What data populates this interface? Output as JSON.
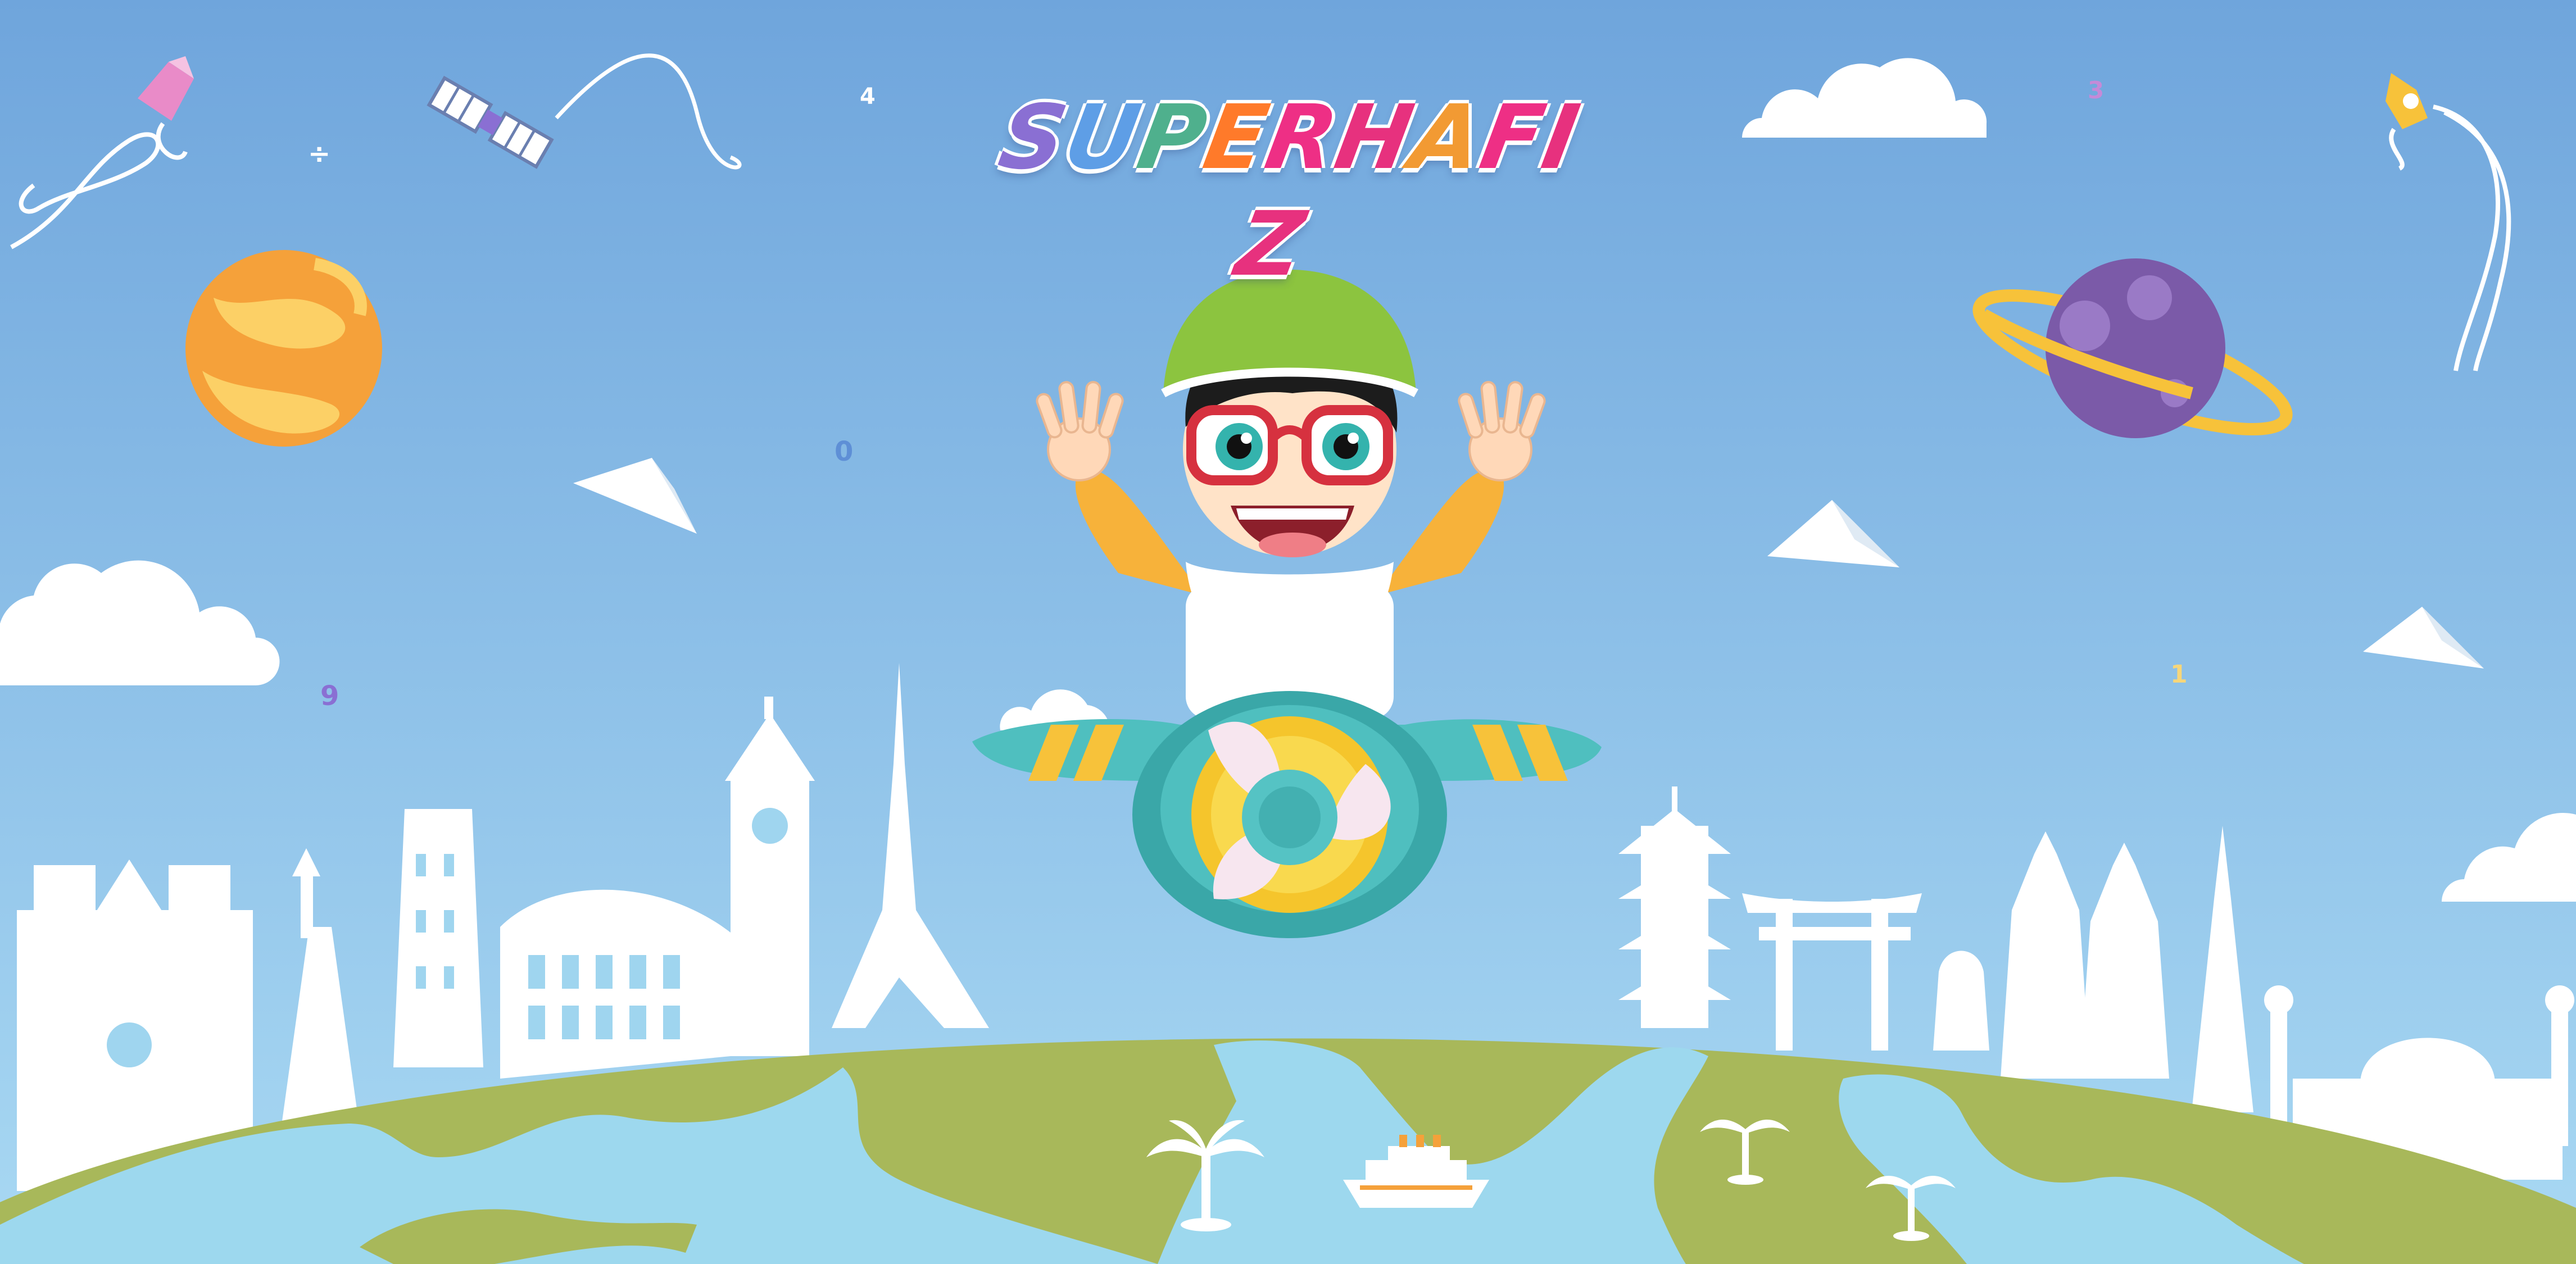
{
  "brand": {
    "logo_text": "SUPERHAFIZ",
    "logo_letters": [
      "S",
      "U",
      "P",
      "E",
      "R",
      "H",
      "A",
      "F",
      "I",
      "Z"
    ],
    "logo_colors": [
      "#8a6fd3",
      "#5e9ee6",
      "#4fb08d",
      "#ff7a2a",
      "#ee2f85",
      "#e7317e",
      "#f29a33",
      "#ee2f85",
      "#e7317e",
      "#e7317e"
    ]
  },
  "scene": {
    "sky_top": "#6fa5dc",
    "sky_bottom": "#a9d9f3",
    "land_color": "#a8b85a",
    "ocean_color": "#9dd8ee",
    "helmet_color": "#8cc43f",
    "shirt_color": "#f7b23a",
    "plane_color": "#4fbfbf",
    "propeller_color": "#f5c52c",
    "planet_purple": "#7b5aa8",
    "planet_orange": "#f5a13a",
    "floating_digits": [
      "4",
      "0",
      "9",
      "3",
      "1"
    ]
  },
  "icons": [
    "kite-icon",
    "satellite-icon",
    "planet-icon",
    "paper-plane-icon",
    "cloud-icon",
    "eiffel-tower-icon",
    "big-ben-icon",
    "palm-tree-icon",
    "cruise-ship-icon"
  ]
}
